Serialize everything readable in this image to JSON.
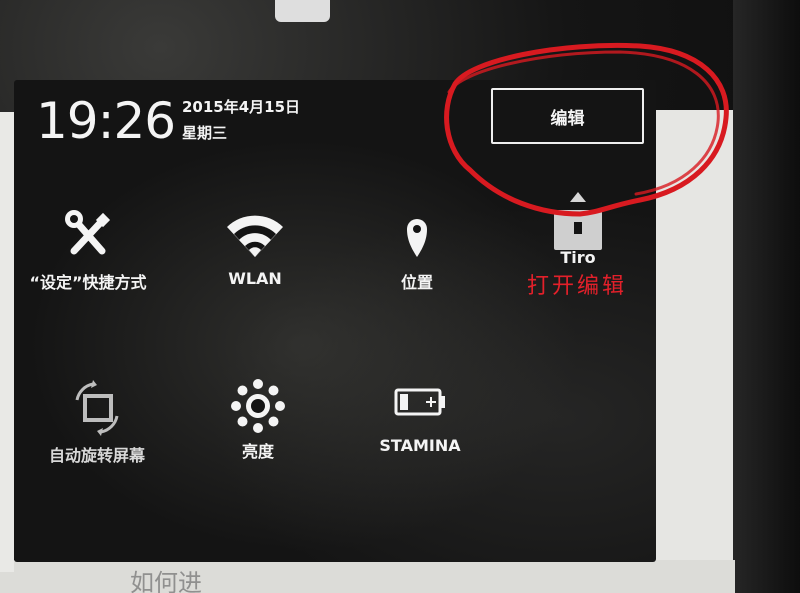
{
  "status": {
    "time": "19:26",
    "date": "2015年4月15日",
    "weekday": "星期三"
  },
  "edit_button_label": "编辑",
  "tiles": [
    {
      "label": "“设定”快捷方式",
      "icon": "settings-tools-icon"
    },
    {
      "label": "WLAN",
      "icon": "wifi-icon"
    },
    {
      "label": "位置",
      "icon": "location-icon"
    },
    {
      "label": "Tiro",
      "icon": "throw-icon"
    },
    {
      "label": "自动旋转屏幕",
      "icon": "auto-rotate-icon"
    },
    {
      "label": "亮度",
      "icon": "brightness-icon"
    },
    {
      "label": "STAMINA",
      "icon": "battery-stamina-icon"
    }
  ],
  "annotation": {
    "text": "打开编辑",
    "color": "#e3202a"
  },
  "background_text": "如何进"
}
